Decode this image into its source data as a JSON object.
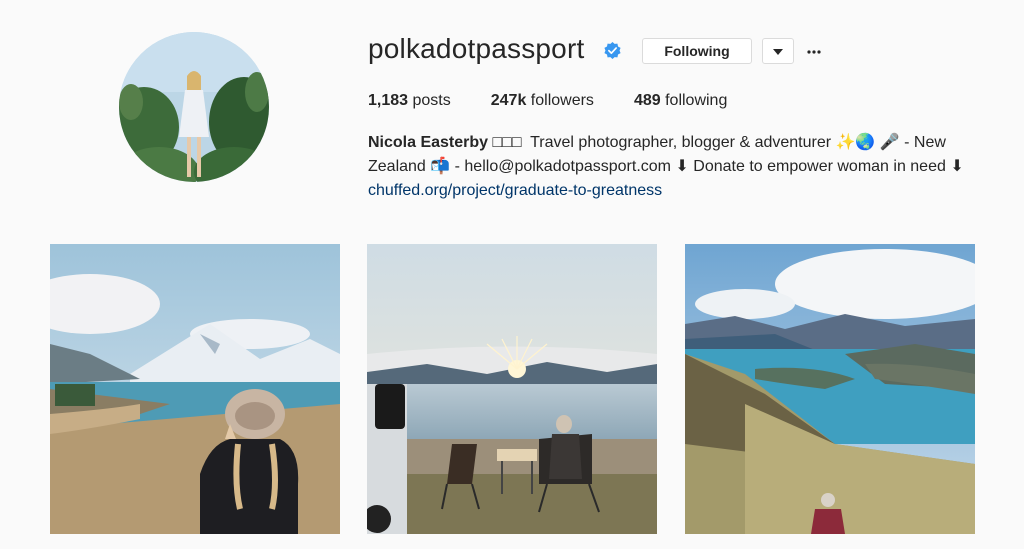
{
  "profile": {
    "username": "polkadotpassport",
    "verified": true,
    "follow_button_label": "Following",
    "dropdown_icon": "caret-down-icon",
    "more_icon": "ellipsis-icon"
  },
  "stats": {
    "posts_count": "1,183",
    "posts_label": "posts",
    "followers_count": "247k",
    "followers_label": "followers",
    "following_count": "489",
    "following_label": "following"
  },
  "bio": {
    "full_name": "Nicola Easterby",
    "flag_placeholders": "□□□",
    "line1": "Travel photographer, blogger & adventurer ✨🌏 🎤 - New",
    "line2": "Zealand 📬 - hello@polkadotpassport.com ⬇ Donate to empower woman in need ⬇",
    "link": "chuffed.org/project/graduate-to-greatness"
  },
  "posts": [
    {
      "subject": "woman in hat overlooking mountain lake"
    },
    {
      "subject": "camp chairs by lake at sunrise"
    },
    {
      "subject": "hiker on ridge above blue lake"
    }
  ],
  "colors": {
    "background": "#fafafa",
    "text": "#262626",
    "link": "#003569",
    "verified_badge": "#3897f0",
    "border": "#dbdbdb"
  }
}
